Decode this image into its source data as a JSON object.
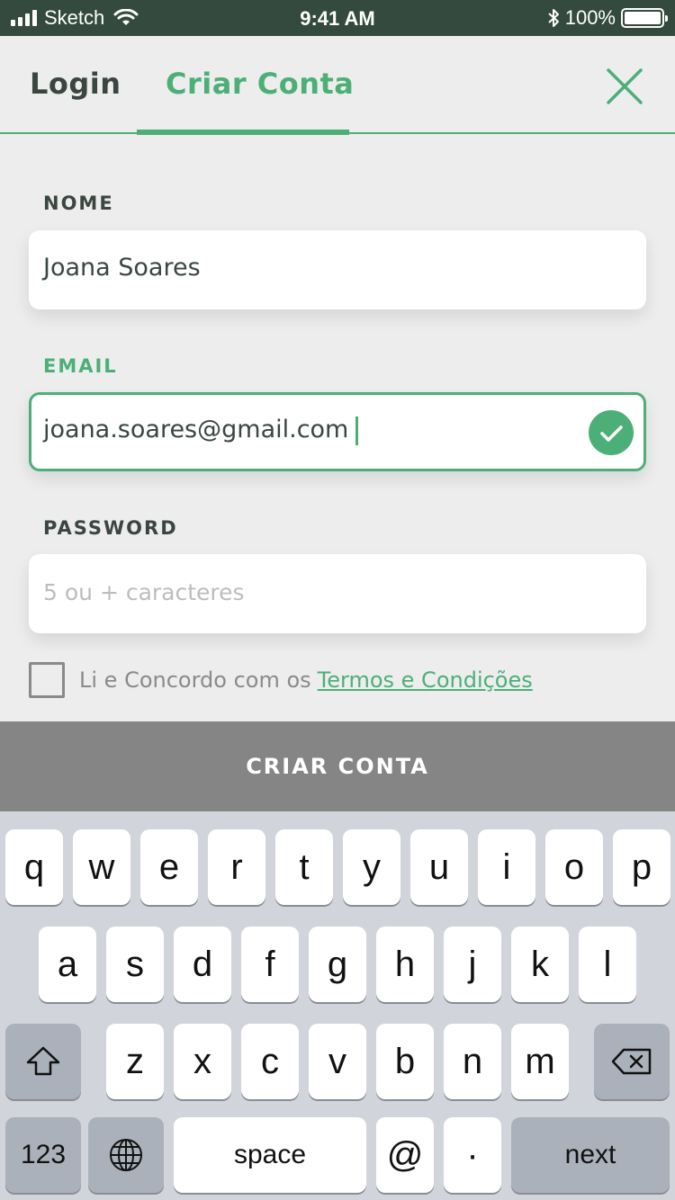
{
  "status_bar": {
    "carrier": "Sketch",
    "time": "9:41 AM",
    "battery": "100%"
  },
  "tabs": {
    "login": "Login",
    "create": "Criar Conta"
  },
  "form": {
    "name": {
      "label": "NOME",
      "value": "Joana Soares"
    },
    "email": {
      "label": "EMAIL",
      "value": "joana.soares@gmail.com"
    },
    "password": {
      "label": "PASSWORD",
      "placeholder": "5 ou + caracteres"
    },
    "terms": {
      "text": "Li e Concordo com os",
      "link": "Termos e Condições",
      "checked": false
    }
  },
  "submit_label": "CRIAR CONTA",
  "keyboard": {
    "row1": [
      "q",
      "w",
      "e",
      "r",
      "t",
      "y",
      "u",
      "i",
      "o",
      "p"
    ],
    "row2": [
      "a",
      "s",
      "d",
      "f",
      "g",
      "h",
      "j",
      "k",
      "l"
    ],
    "row3": [
      "z",
      "x",
      "c",
      "v",
      "b",
      "n",
      "m"
    ],
    "numbers_label": "123",
    "space_label": "space",
    "at_label": "@",
    "dot_label": "·",
    "next_label": "next"
  },
  "colors": {
    "accent": "#4caf78",
    "status_bar": "#344a3e",
    "text": "#3a463f",
    "button": "#858585"
  }
}
